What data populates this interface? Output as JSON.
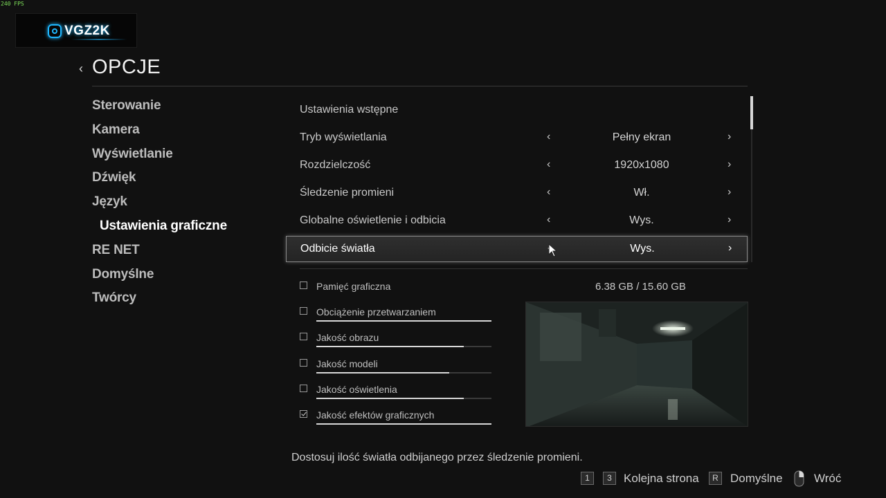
{
  "overlay": {
    "fps": "240 FPS"
  },
  "logo": {
    "text": "VGZ2K"
  },
  "header": {
    "title": "OPCJE"
  },
  "nav": {
    "items": [
      {
        "label": "Sterowanie",
        "active": false
      },
      {
        "label": "Kamera",
        "active": false
      },
      {
        "label": "Wyświetlanie",
        "active": false
      },
      {
        "label": "Dźwięk",
        "active": false
      },
      {
        "label": "Język",
        "active": false
      },
      {
        "label": "Ustawienia graficzne",
        "active": true
      },
      {
        "label": "RE NET",
        "active": false
      },
      {
        "label": "Domyślne",
        "active": false
      },
      {
        "label": "Twórcy",
        "active": false
      }
    ]
  },
  "settings": {
    "rows": [
      {
        "label": "Ustawienia wstępne",
        "value": ""
      },
      {
        "label": "Tryb wyświetlania",
        "value": "Pełny ekran"
      },
      {
        "label": "Rozdzielczość",
        "value": "1920x1080"
      },
      {
        "label": "Śledzenie promieni",
        "value": "Wł."
      },
      {
        "label": "Globalne oświetlenie i odbicia",
        "value": "Wys."
      },
      {
        "label": "Odbicie światła",
        "value": "Wys.",
        "selected": true
      }
    ]
  },
  "performance": {
    "vram": {
      "label": "Pamięć graficzna",
      "used": "6.38 GB",
      "separator": "/",
      "total": "15.60 GB",
      "value_text": "6.38 GB  /  15.60 GB"
    },
    "bars": [
      {
        "label": "Obciążenie przetwarzaniem",
        "level": 1.0,
        "checked": false
      },
      {
        "label": "Jakość obrazu",
        "level": 0.84,
        "checked": false
      },
      {
        "label": "Jakość modeli",
        "level": 0.76,
        "checked": false
      },
      {
        "label": "Jakość oświetlenia",
        "level": 0.84,
        "checked": false
      },
      {
        "label": "Jakość efektów graficznych",
        "level": 1.0,
        "checked": true
      }
    ]
  },
  "description": "Dostosuj ilość światła odbijanego przez śledzenie promieni.",
  "footer": {
    "key_1": "1",
    "key_3": "3",
    "next_page_label": "Kolejna strona",
    "key_r": "R",
    "defaults_label": "Domyślne",
    "back_label": "Wróć"
  },
  "colors": {
    "background": "#111111",
    "selected_row_border": "#8a8a8a",
    "logo_accent": "#1fb7ff",
    "fps_text": "#7ee05a"
  }
}
